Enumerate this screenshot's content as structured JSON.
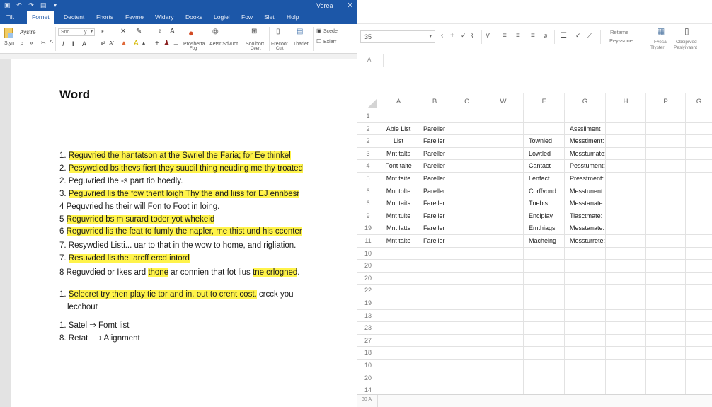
{
  "word": {
    "qat_icons": [
      "save-icon",
      "undo-icon",
      "redo-icon",
      "print-icon",
      "customize-icon"
    ],
    "window_title": "Verea",
    "close_glyph": "✕",
    "tabs": [
      {
        "label": "Tilt",
        "active": false
      },
      {
        "label": "Fornet",
        "active": true
      },
      {
        "label": "Dectent",
        "active": false
      },
      {
        "label": "Fhorts",
        "active": false
      },
      {
        "label": "Fevme",
        "active": false
      },
      {
        "label": "Widary",
        "active": false
      },
      {
        "label": "Dooks",
        "active": false
      },
      {
        "label": "Logiel",
        "active": false
      },
      {
        "label": "Fow",
        "active": false
      },
      {
        "label": "Slet",
        "active": false
      },
      {
        "label": "Holp",
        "active": false
      }
    ],
    "ribbon": {
      "paste_label": "Aystre",
      "style_label": "Styn",
      "font_name": "Sno",
      "font_size": "y",
      "bold": "I",
      "italic": "I",
      "text_effects": "A",
      "group_large": [
        {
          "label": "Prosherta",
          "sub": "Fog"
        },
        {
          "label": "Aetsr Sdvuot",
          "sub": ""
        },
        {
          "label": "Sooibort",
          "sub": "Ceert"
        },
        {
          "label": "Frecoot",
          "sub": "Cuit"
        },
        {
          "label": "Tharlet",
          "sub": ""
        }
      ],
      "editing": [
        {
          "label": "Scede"
        },
        {
          "label": "Exlerr"
        }
      ]
    },
    "document": {
      "title": "Word",
      "lines": [
        {
          "num": "1.",
          "text": "Reguvried the hantatson at the Swriel the Faria; for Ee thinkel",
          "highlight": "full"
        },
        {
          "num": "2.",
          "text": "Pesywdied bs thevs fiert they suudil thing neuding me thy troated",
          "highlight": "full"
        },
        {
          "num": "2.",
          "text": "Peguvried Ihe -s part tio hoedly.",
          "highlight": "none"
        },
        {
          "num": "3.",
          "text": "Peguvried lis the fow thent loigh Thy the and liiss for EJ ennbesr",
          "highlight": "full"
        },
        {
          "num": "4",
          "text": "Pequvried hs their will Fon to Foot in loing.",
          "highlight": "none"
        },
        {
          "num": "5",
          "text": "Reguvried bs m surard toder yot whekeid",
          "highlight": "full"
        },
        {
          "num": "6",
          "text": "Reguvried lis the feat to fumly the napler, me thist und his cconter",
          "highlight": "full"
        },
        {
          "num": "7.",
          "text": "Resywdied Listi... uar to that in the wow to home, and rigliation.",
          "highlight": "none"
        },
        {
          "num": "7.",
          "text": "Resuvded lis the, arcff ercd intord",
          "highlight": "full"
        },
        {
          "num": "8",
          "segments": [
            {
              "text": "Reguvdied or Ikes ard ",
              "hl": false
            },
            {
              "text": "thone",
              "hl": true
            },
            {
              "text": " ar connien that fot lius ",
              "hl": false
            },
            {
              "text": "tne crlogned",
              "hl": true
            },
            {
              "text": ".",
              "hl": false
            }
          ]
        },
        {
          "num": "1.",
          "segments": [
            {
              "text": "Selecret try then play tie tor and in. out to crent cost.",
              "hl": true
            },
            {
              "text": " crcck you",
              "hl": false
            }
          ],
          "continuation": "lecchout"
        },
        {
          "num": "1.",
          "text": "Satel ⇒ Fomt list",
          "highlight": "none"
        },
        {
          "num": "8.",
          "text": "Retat ⟶ Alignment",
          "highlight": "none"
        }
      ]
    }
  },
  "excel": {
    "name_box": "35",
    "toolbar": {
      "group1_label": "Retame",
      "group1_sub": "Peyssone",
      "btn1_label": "Fvesa",
      "btn1_sub": "Tlyster",
      "btn2_label": "Obsiprved",
      "btn2_sub": "Pesiyivasnt"
    },
    "formula_bar_icon": "A",
    "columns": [
      "A",
      "B",
      "C",
      "W",
      "F",
      "G",
      "H",
      "P",
      "G"
    ],
    "rows": [
      {
        "hdr": "1",
        "A": "",
        "B": "",
        "F": "",
        "G": ""
      },
      {
        "hdr": "2",
        "A": "Able List",
        "B": "Pareller",
        "F": "",
        "G": "Asssliment"
      },
      {
        "hdr": "2",
        "A": "List",
        "B": "Fareller",
        "F": "Townled",
        "G": "Messtiment:"
      },
      {
        "hdr": "3",
        "A": "Mnt talts",
        "B": "Pareller",
        "F": "Lowtled",
        "G": "Messtumate:"
      },
      {
        "hdr": "4",
        "A": "Font talte",
        "B": "Pareller",
        "F": "Cantact",
        "G": "Pesstument:"
      },
      {
        "hdr": "5",
        "A": "Mnt taite",
        "B": "Pareller",
        "F": "Lenfact",
        "G": "Presstment:"
      },
      {
        "hdr": "6",
        "A": "Mnt tolte",
        "B": "Pareller",
        "F": "Corffvond",
        "G": "Messtunent:"
      },
      {
        "hdr": "6",
        "A": "Mnt taits",
        "B": "Fareller",
        "F": "Tnebis",
        "G": "Messtanate:"
      },
      {
        "hdr": "9",
        "A": "Mnt tulte",
        "B": "Fareller",
        "F": "Enciplay",
        "G": "Tiasctmate:"
      },
      {
        "hdr": "19",
        "A": "Mnt latts",
        "B": "Fareller",
        "F": "Emthiags",
        "G": "Messtanate:"
      },
      {
        "hdr": "11",
        "A": "Mnt taite",
        "B": "Fareller",
        "F": "Macheing",
        "G": "Messturrete:"
      },
      {
        "hdr": "10"
      },
      {
        "hdr": "20"
      },
      {
        "hdr": "20"
      },
      {
        "hdr": "22"
      },
      {
        "hdr": "19"
      },
      {
        "hdr": "13"
      },
      {
        "hdr": "23"
      },
      {
        "hdr": "27"
      },
      {
        "hdr": "18"
      },
      {
        "hdr": "10"
      },
      {
        "hdr": "20"
      },
      {
        "hdr": "14"
      }
    ],
    "sheet_tab": "30 A"
  }
}
